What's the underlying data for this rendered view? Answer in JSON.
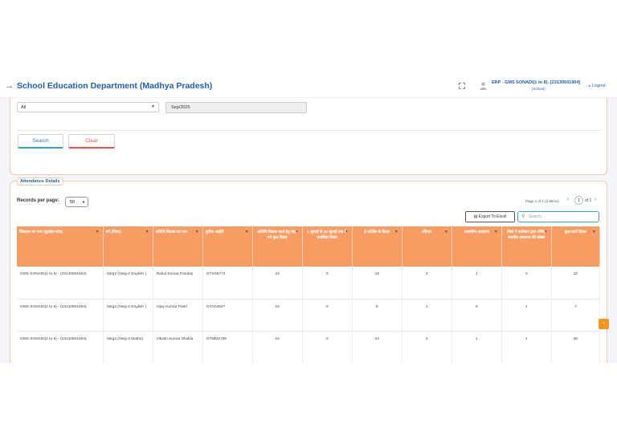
{
  "header": {
    "title": "School Education Department (Madhya Pradesh)",
    "user_name": "ERP - GMS SONADI(1 to 8)- [23130501904]",
    "user_role": "(School)",
    "logout_label": "Logout"
  },
  "filters": {
    "dropdown_value": "All",
    "month_value": "Sep/2025",
    "search_label": "Search",
    "clear_label": "Clear"
  },
  "attendance": {
    "section_title": "Attendance Details",
    "records_label": "Records per page:",
    "records_value": "50",
    "page_info": "Page 1 of 1 (3 items)",
    "current_page": "1",
    "of_label": "of 1",
    "export_label": "Export To Excel",
    "search_placeholder": "Search...",
    "columns": [
      "विद्यालय का नाम (यूडाईस कोड)",
      "वर्ग (विषय)",
      "अतिथि शिक्षक का नाम",
      "यूनीक आईडी",
      "अतिथि शिक्षक कार्य हेतु चाहा गये कुल दिवस",
      "1 जुलाई से 20 जुलाई तक के उपस्थित दिवस",
      "ई-अटेंडेंस के दिवस",
      "रविवार",
      "शासकीय अवकाश",
      "जिले में कलेक्टर द्वारा घोषित स्थानीय अवकाश की संख्या",
      "कुल कार्य दिवस"
    ],
    "rows": [
      [
        "GMS SONADI(1 to 8) - (23130501904)",
        "Varg2 (Varg-2 English )",
        "Rahul Kumar Panday",
        "GTSS8773",
        "24",
        "0",
        "18",
        "3",
        "1",
        "0",
        "22"
      ],
      [
        "GMS SONADI(1 to 8) - (23130501904)",
        "Varg2 (Varg-2 English )",
        "Vijay Kumar Patel",
        "GTAD4627",
        "24",
        "0",
        "5",
        "1",
        "6",
        "1",
        "7"
      ],
      [
        "GMS SONADI(1 to 8) - (23130501904)",
        "Varg2 (Varg-2 Maths)",
        "Vikash Kumar Shukla",
        "GTMM2789",
        "24",
        "0",
        "24",
        "4",
        "1",
        "1",
        "30"
      ]
    ]
  }
}
